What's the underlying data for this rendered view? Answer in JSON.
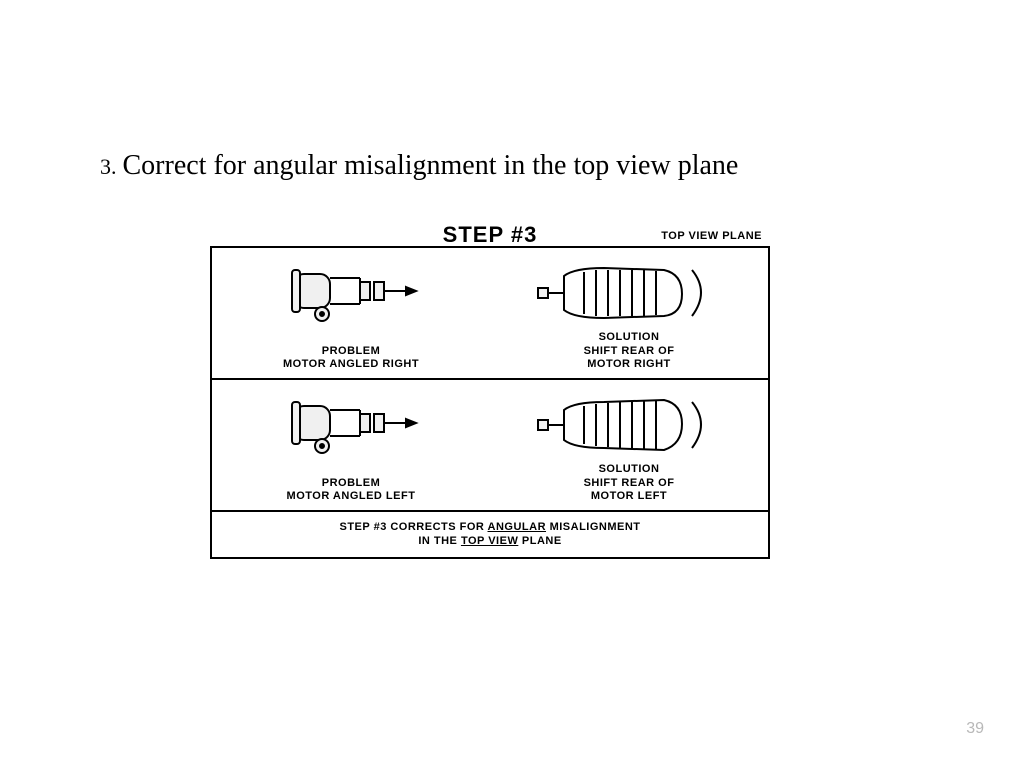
{
  "title": {
    "num": "3.",
    "text": "Correct for angular misalignment in the top view plane"
  },
  "figure": {
    "step_header": "STEP #3",
    "topview_label": "TOP VIEW PLANE",
    "row1": {
      "problem_label": "PROBLEM",
      "problem_text": "MOTOR ANGLED RIGHT",
      "solution_label": "SOLUTION",
      "solution_text1": "SHIFT REAR OF",
      "solution_text2": "MOTOR RIGHT"
    },
    "row2": {
      "problem_label": "PROBLEM",
      "problem_text": "MOTOR ANGLED LEFT",
      "solution_label": "SOLUTION",
      "solution_text1": "SHIFT REAR OF",
      "solution_text2": "MOTOR LEFT"
    },
    "footer_a": "STEP #3 CORRECTS FOR ",
    "footer_u1": "ANGULAR",
    "footer_b": " MISALIGNMENT",
    "footer_c": "IN THE ",
    "footer_u2": "TOP VIEW",
    "footer_d": " PLANE"
  },
  "page_number": "39"
}
